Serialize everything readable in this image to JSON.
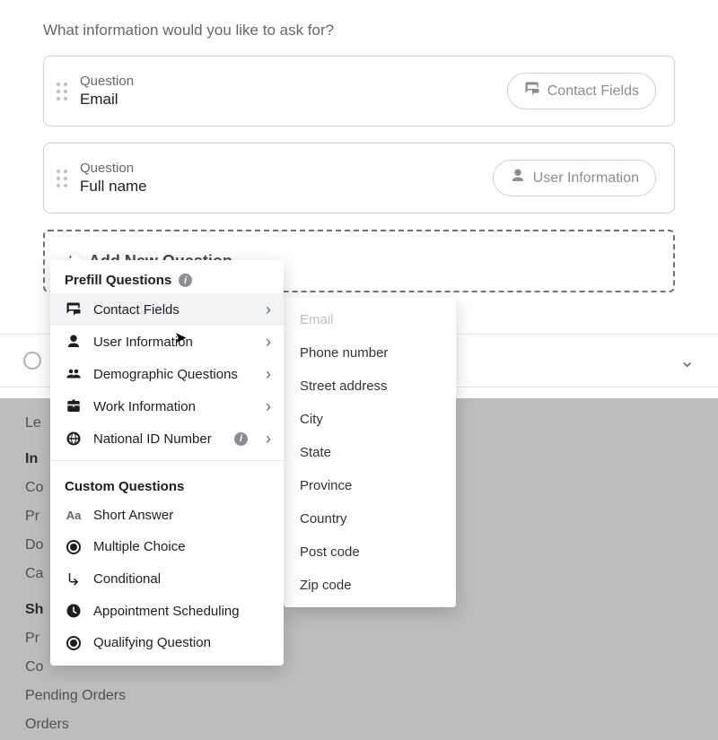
{
  "heading": "What information would you like to ask for?",
  "questions": [
    {
      "label": "Question",
      "value": "Email",
      "chip": "Contact Fields"
    },
    {
      "label": "Question",
      "value": "Full name",
      "chip": "User Information"
    }
  ],
  "addButton": "Add New Question",
  "menu": {
    "prefillTitle": "Prefill Questions",
    "prefillItems": [
      {
        "label": "Contact Fields"
      },
      {
        "label": "User Information"
      },
      {
        "label": "Demographic Questions"
      },
      {
        "label": "Work Information"
      },
      {
        "label": "National ID Number"
      }
    ],
    "customTitle": "Custom Questions",
    "customItems": [
      {
        "label": "Short Answer"
      },
      {
        "label": "Multiple Choice"
      },
      {
        "label": "Conditional"
      },
      {
        "label": "Appointment Scheduling"
      },
      {
        "label": "Qualifying Question"
      }
    ]
  },
  "submenu": [
    "Email",
    "Phone number",
    "Street address",
    "City",
    "State",
    "Province",
    "Country",
    "Post code",
    "Zip code"
  ],
  "bgSidebar": {
    "le": "Le",
    "hdr1": "In",
    "items1": [
      "Co",
      "Pr",
      "Do",
      "Ca"
    ],
    "hdr2": "Sh",
    "items2": [
      "Pr",
      "Co",
      "Pending Orders",
      "Orders"
    ]
  }
}
